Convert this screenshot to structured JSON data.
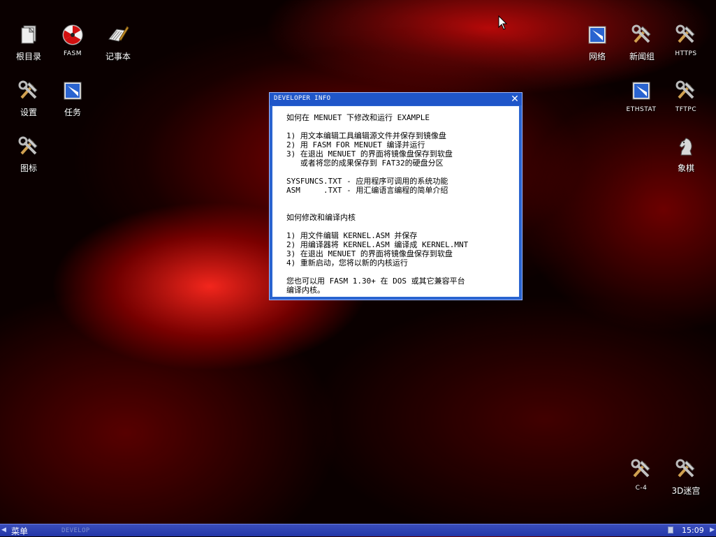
{
  "desktop": {
    "icons_left": [
      {
        "label": "根目录",
        "icon": "files-icon"
      },
      {
        "label": "FASM",
        "icon": "radiation-icon"
      },
      {
        "label": "记事本",
        "icon": "notepad-icon"
      },
      {
        "label": "设置",
        "icon": "tools-icon"
      },
      {
        "label": "任务",
        "icon": "window-app-icon"
      },
      {
        "label": "图标",
        "icon": "tools-icon"
      }
    ],
    "icons_right": [
      {
        "label": "网络",
        "icon": "window-app-icon"
      },
      {
        "label": "新闻组",
        "icon": "tools-icon"
      },
      {
        "label": "HTTPS",
        "icon": "tools-icon"
      },
      {
        "label": "ETHSTAT",
        "icon": "window-app-icon"
      },
      {
        "label": "TFTPC",
        "icon": "tools-icon"
      },
      {
        "label": "象棋",
        "icon": "chess-knight-icon"
      },
      {
        "label": "C-4",
        "icon": "tools-icon"
      },
      {
        "label": "3D迷宫",
        "icon": "tools-icon"
      }
    ]
  },
  "window": {
    "title": "DEVELOPER INFO",
    "close_icon": "close-icon",
    "lines": [
      "如何在 MENUET 下修改和运行 EXAMPLE",
      "",
      "1) 用文本编辑工具编辑源文件并保存到镜像盘",
      "2) 用 FASM FOR MENUET 编译并运行",
      "3) 在退出 MENUET 的界面将镜像盘保存到软盘",
      "   或者将您的成果保存到 FAT32的硬盘分区",
      "",
      "SYSFUNCS.TXT - 应用程序可调用的系统功能",
      "ASM     .TXT - 用汇编语言编程的简单介绍",
      "",
      "",
      "如何修改和编译内核",
      "",
      "1) 用文件编辑 KERNEL.ASM 并保存",
      "2) 用编译器将 KERNEL.ASM 编译成 KERNEL.MNT",
      "3) 在退出 MENUET 的界面将镜像盘保存到软盘",
      "4) 重新启动，您将以新的内核运行",
      "",
      "您也可以用 FASM 1.30+ 在 DOS 或其它兼容平台",
      "编译内核。"
    ]
  },
  "taskbar": {
    "menu_label": "菜单",
    "task_label": "DEVELOP",
    "clock": "15:09",
    "left_arrow_icon": "arrow-left-icon",
    "right_arrow_icon": "arrow-right-icon"
  },
  "colors": {
    "window_frame": "#2a64d0",
    "taskbar": "#2236a8",
    "background": "#0a0000"
  }
}
